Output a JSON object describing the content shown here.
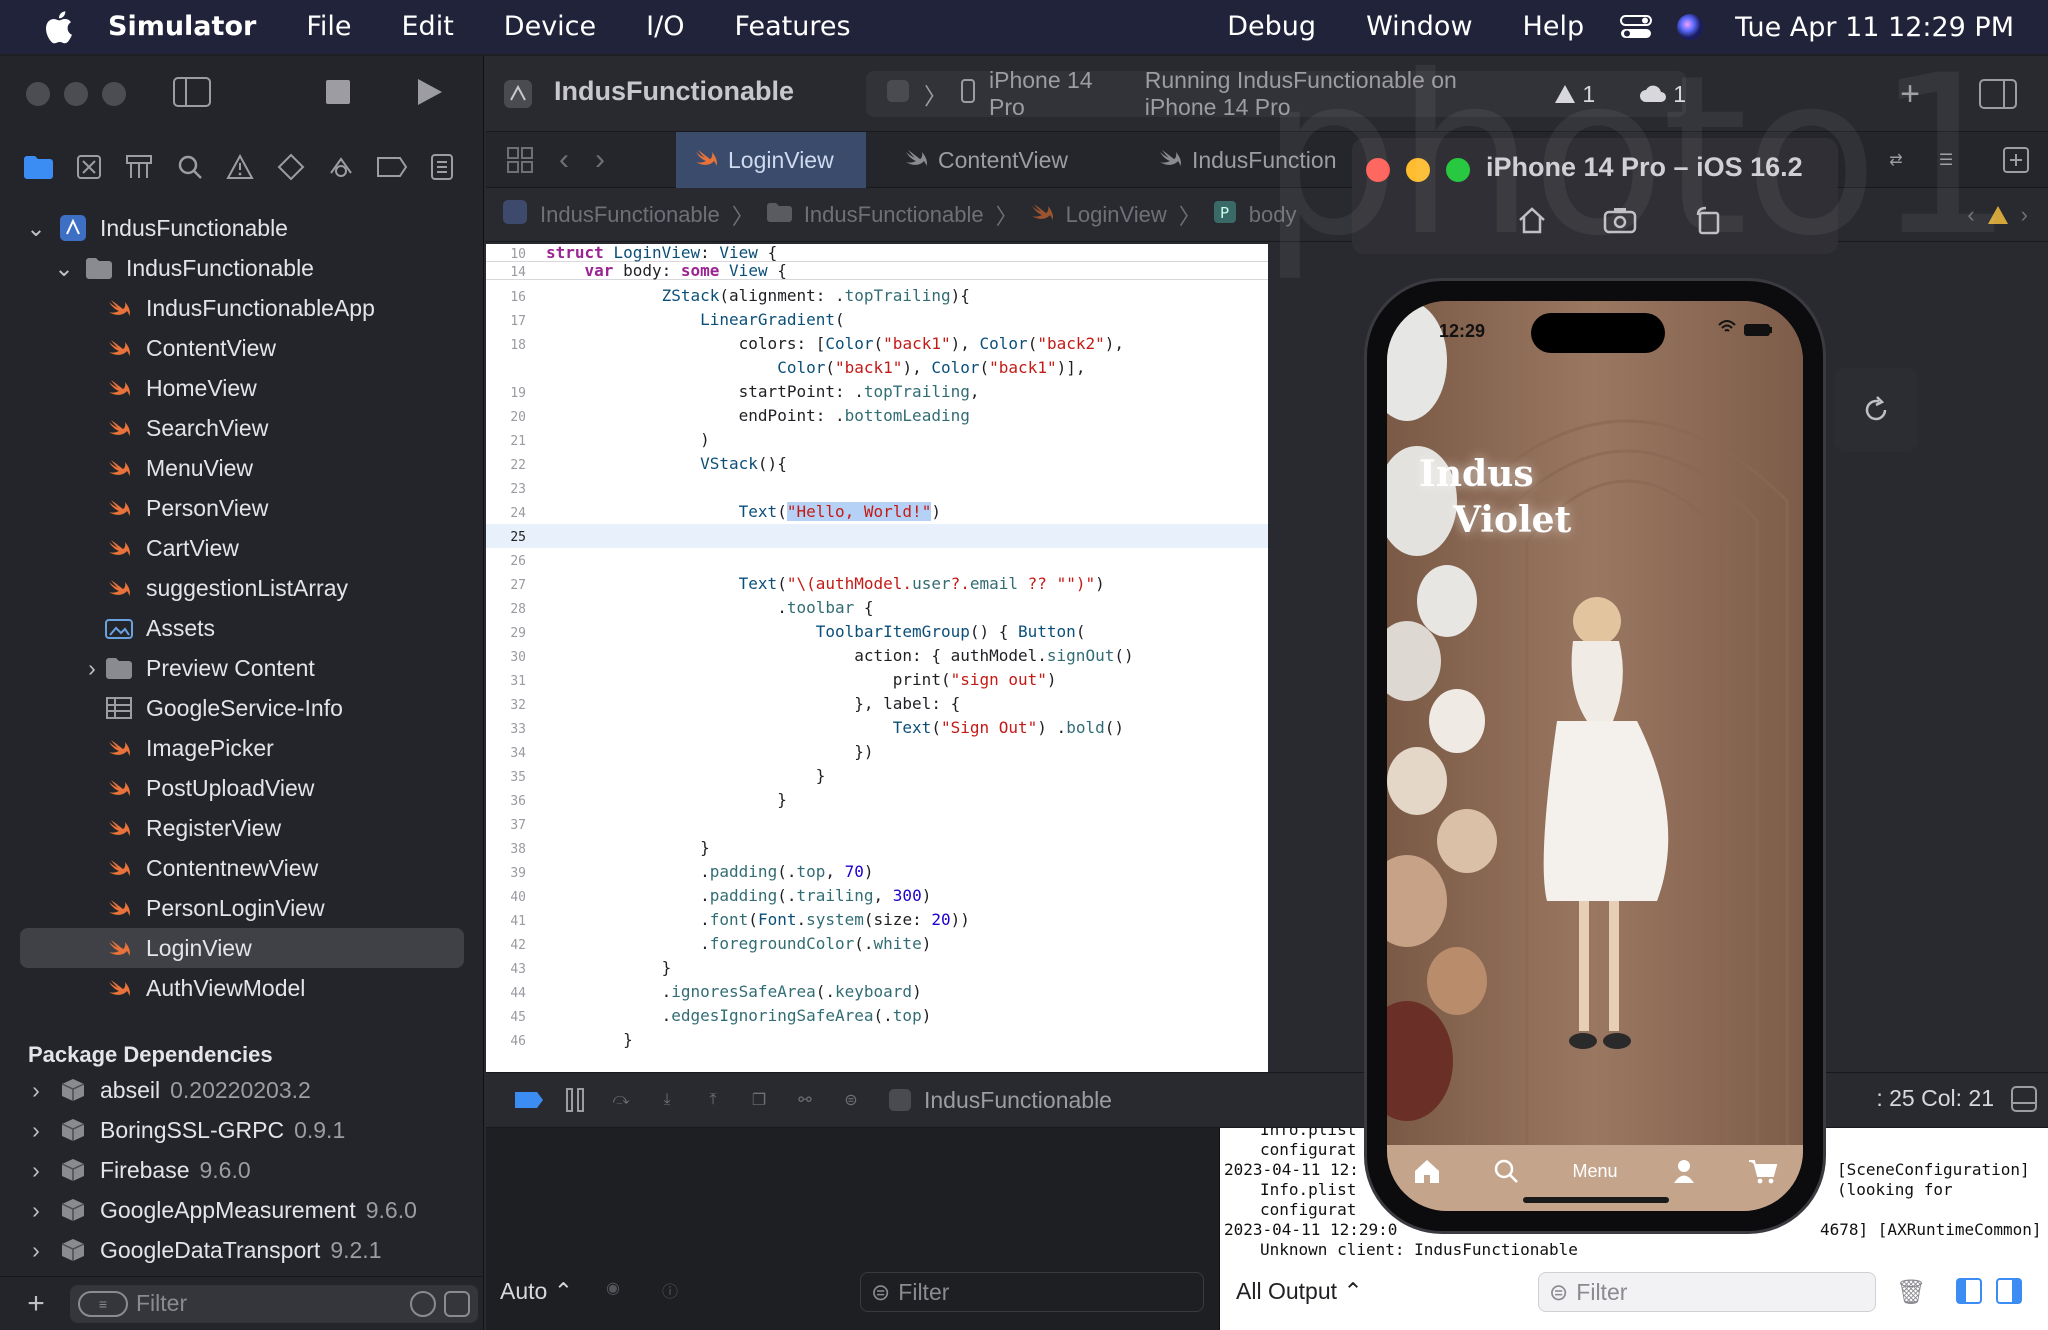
{
  "menubar": {
    "app_name": "Simulator",
    "items": [
      "File",
      "Edit",
      "Device",
      "I/O",
      "Features",
      "Debug",
      "Window",
      "Help"
    ],
    "clock": "Tue Apr 11  12:29 PM"
  },
  "xcode": {
    "project_title": "IndusFunctionable",
    "scheme": {
      "device": "iPhone 14 Pro",
      "status": "Running IndusFunctionable on iPhone 14 Pro",
      "warnings": "1",
      "issues": "1"
    },
    "tabs": [
      "LoginView",
      "ContentView",
      "IndusFunction"
    ],
    "jumpbar": [
      "IndusFunctionable",
      "IndusFunctionable",
      "LoginView",
      "body"
    ],
    "navigator": {
      "project": "IndusFunctionable",
      "group": "IndusFunctionable",
      "files": [
        {
          "name": "IndusFunctionableApp",
          "icon": "swift-icon"
        },
        {
          "name": "ContentView",
          "icon": "swift-icon"
        },
        {
          "name": "HomeView",
          "icon": "swift-icon"
        },
        {
          "name": "SearchView",
          "icon": "swift-icon"
        },
        {
          "name": "MenuView",
          "icon": "swift-icon"
        },
        {
          "name": "PersonView",
          "icon": "swift-icon"
        },
        {
          "name": "CartView",
          "icon": "swift-icon"
        },
        {
          "name": "suggestionListArray",
          "icon": "swift-icon"
        },
        {
          "name": "Assets",
          "icon": "assets-icon"
        },
        {
          "name": "Preview Content",
          "icon": "folder-icon"
        },
        {
          "name": "GoogleService-Info",
          "icon": "plist-icon"
        },
        {
          "name": "ImagePicker",
          "icon": "swift-icon"
        },
        {
          "name": "PostUploadView",
          "icon": "swift-icon"
        },
        {
          "name": "RegisterView",
          "icon": "swift-icon"
        },
        {
          "name": "ContentnewView",
          "icon": "swift-icon"
        },
        {
          "name": "PersonLoginView",
          "icon": "swift-icon"
        },
        {
          "name": "LoginView",
          "icon": "swift-icon"
        },
        {
          "name": "AuthViewModel",
          "icon": "swift-icon"
        }
      ],
      "packages_header": "Package Dependencies",
      "packages": [
        {
          "name": "abseil",
          "version": "0.20220203.2"
        },
        {
          "name": "BoringSSL-GRPC",
          "version": "0.9.1"
        },
        {
          "name": "Firebase",
          "version": "9.6.0"
        },
        {
          "name": "GoogleAppMeasurement",
          "version": "9.6.0"
        },
        {
          "name": "GoogleDataTransport",
          "version": "9.2.1"
        }
      ],
      "filter_placeholder": "Filter"
    },
    "code": {
      "sticky": [
        {
          "n": "10",
          "t": "struct LoginView: View {"
        },
        {
          "n": "14",
          "t": "    var body: some View {"
        }
      ],
      "lines": [
        {
          "n": "16",
          "t": "            ZStack(alignment: .topTrailing){"
        },
        {
          "n": "17",
          "t": "                LinearGradient("
        },
        {
          "n": "18",
          "t": "                    colors: [Color(\"back1\"), Color(\"back2\"),"
        },
        {
          "n": "",
          "t": "                        Color(\"back1\"), Color(\"back1\")],"
        },
        {
          "n": "19",
          "t": "                    startPoint: .topTrailing,"
        },
        {
          "n": "20",
          "t": "                    endPoint: .bottomLeading"
        },
        {
          "n": "21",
          "t": "                )"
        },
        {
          "n": "22",
          "t": "                VStack(){"
        },
        {
          "n": "23",
          "t": ""
        },
        {
          "n": "24",
          "t": "                    Text(\"Hello, World!\")"
        },
        {
          "n": "25",
          "t": ""
        },
        {
          "n": "26",
          "t": ""
        },
        {
          "n": "27",
          "t": "                    Text(\"\\(authModel.user?.email ?? \"\")\")"
        },
        {
          "n": "28",
          "t": "                        .toolbar {"
        },
        {
          "n": "29",
          "t": "                            ToolbarItemGroup() { Button("
        },
        {
          "n": "30",
          "t": "                                action: { authModel.signOut()"
        },
        {
          "n": "31",
          "t": "                                    print(\"sign out\")"
        },
        {
          "n": "32",
          "t": "                                }, label: {"
        },
        {
          "n": "33",
          "t": "                                    Text(\"Sign Out\") .bold()"
        },
        {
          "n": "34",
          "t": "                                })"
        },
        {
          "n": "35",
          "t": "                            }"
        },
        {
          "n": "36",
          "t": "                        }"
        },
        {
          "n": "37",
          "t": ""
        },
        {
          "n": "38",
          "t": "                }"
        },
        {
          "n": "39",
          "t": "                .padding(.top, 70)"
        },
        {
          "n": "40",
          "t": "                .padding(.trailing, 300)"
        },
        {
          "n": "41",
          "t": "                .font(Font.system(size: 20))"
        },
        {
          "n": "42",
          "t": "                .foregroundColor(.white)"
        },
        {
          "n": "43",
          "t": "            }"
        },
        {
          "n": "44",
          "t": "            .ignoresSafeArea(.keyboard)"
        },
        {
          "n": "45",
          "t": "            .edgesIgnoringSafeArea(.top)"
        },
        {
          "n": "46",
          "t": "        }"
        }
      ],
      "current_line": "25"
    },
    "debug": {
      "target": "IndusFunctionable",
      "line_col": ": 25  Col: 21",
      "auto_label": "Auto",
      "filter_placeholder": "Filter",
      "output_label": "All Output",
      "console_filter_placeholder": "Filter"
    },
    "console": [
      "Info.plist",
      "configurat",
      "2023-04-11 12:",
      "Info.plist",
      "configurat",
      "2023-04-11 12:29:0",
      "Unknown client: IndusFunctionable"
    ],
    "console_right": [
      "[SceneConfiguration]",
      "(looking for",
      "4678] [AXRuntimeCommon]"
    ]
  },
  "simulator": {
    "title": "iPhone 14 Pro – iOS 16.2",
    "device_time": "12:29",
    "brand_line1": "Indus",
    "brand_line2": "Violet",
    "tab_menu_label": "Menu"
  },
  "watermark": "photo1",
  "colors": {
    "accent": "#3b8df3",
    "menubar": "#20233a",
    "swift_orange": "#e8733a"
  }
}
